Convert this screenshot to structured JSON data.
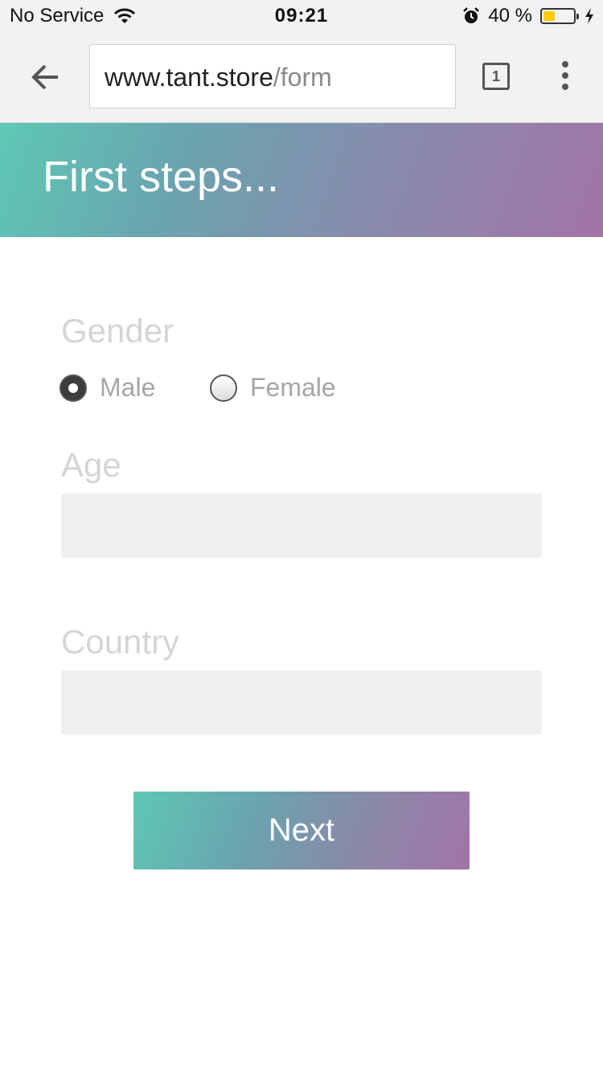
{
  "status_bar": {
    "carrier": "No Service",
    "time": "09:21",
    "battery_percent": "40 %",
    "battery_level": 0.4,
    "battery_color": "#ffcc00",
    "icons": [
      "wifi-icon",
      "alarm-icon",
      "battery-icon",
      "charging-bolt-icon"
    ]
  },
  "browser": {
    "url_domain": "www.tant.store",
    "url_path": "/form",
    "tab_count": "1",
    "icons": [
      "back-arrow-icon",
      "tabs-icon",
      "more-vert-icon"
    ]
  },
  "header": {
    "title": "First steps..."
  },
  "form": {
    "gender": {
      "label": "Gender",
      "options": [
        {
          "label": "Male",
          "checked": true
        },
        {
          "label": "Female",
          "checked": false
        }
      ]
    },
    "age": {
      "label": "Age",
      "value": ""
    },
    "country": {
      "label": "Country",
      "value": ""
    },
    "next_label": "Next"
  },
  "colors": {
    "gradient_start": "#5ec8b4",
    "gradient_end": "#a274a6",
    "label_text": "#d5d5d5",
    "field_background": "#f1f0ef"
  }
}
